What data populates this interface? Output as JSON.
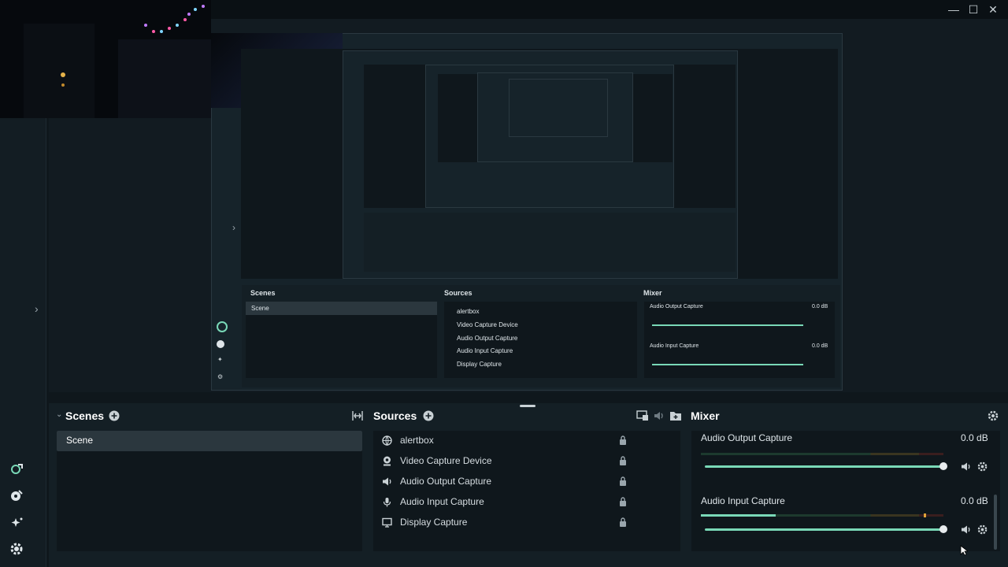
{
  "window": {
    "minimize": "—",
    "maximize": "☐",
    "close": "✕"
  },
  "nav": {
    "icons": [
      "studio-mode-icon",
      "themes-icon",
      "effects-icon",
      "settings-icon"
    ]
  },
  "scenes": {
    "title": "Scenes",
    "items": [
      "Scene"
    ]
  },
  "sources": {
    "title": "Sources",
    "items": [
      {
        "label": "alertbox",
        "icon": "globe-icon"
      },
      {
        "label": "Video Capture Device",
        "icon": "webcam-icon"
      },
      {
        "label": "Audio Output Capture",
        "icon": "speaker-icon"
      },
      {
        "label": "Audio Input Capture",
        "icon": "mic-icon"
      },
      {
        "label": "Display Capture",
        "icon": "monitor-icon"
      }
    ]
  },
  "mixer": {
    "title": "Mixer",
    "channels": [
      {
        "name": "Audio Output Capture",
        "db": "0.0 dB",
        "level": 0.0,
        "volume": 1.0
      },
      {
        "name": "Audio Input Capture",
        "db": "0.0 dB",
        "level": 0.31,
        "volume": 1.0
      }
    ]
  },
  "nested": {
    "scenes_title": "Scenes",
    "scene_item": "Scene",
    "sources_title": "Sources",
    "mixer_title": "Mixer",
    "sources": [
      "alertbox",
      "Video Capture Device",
      "Audio Output Capture",
      "Audio Input Capture",
      "Display Capture"
    ],
    "ch1": "Audio Output Capture",
    "ch2": "Audio Input Capture",
    "db": "0.0 dB"
  },
  "colors": {
    "accent": "#79d8b7",
    "panel": "#0f171c",
    "dock": "#141f25",
    "selected": "#2b373e"
  }
}
